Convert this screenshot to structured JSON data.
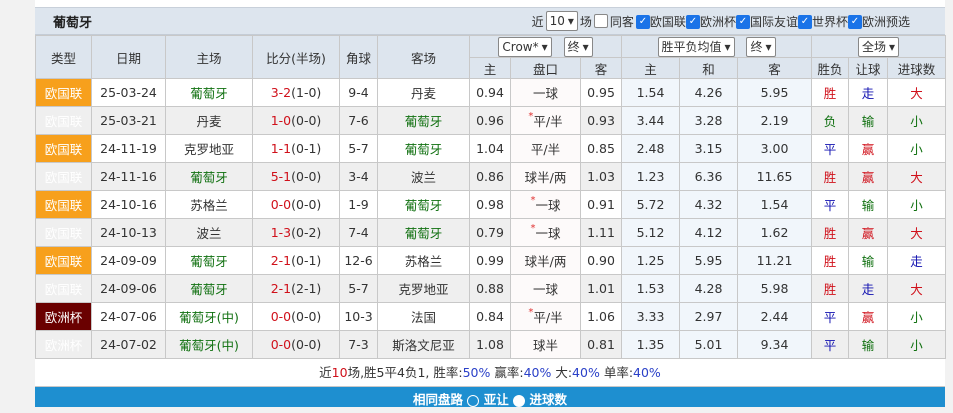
{
  "team": "葡萄牙",
  "filters": {
    "near_label": "近",
    "count": "10",
    "unit_label": "场",
    "same_host_label": "同客",
    "same_host": false,
    "competitions": [
      {
        "label": "欧国联",
        "checked": true
      },
      {
        "label": "欧洲杯",
        "checked": true
      },
      {
        "label": "国际友谊",
        "checked": true
      },
      {
        "label": "世界杯",
        "checked": true
      },
      {
        "label": "欧洲预选",
        "checked": true
      }
    ]
  },
  "headers": {
    "type": "类型",
    "date": "日期",
    "home": "主场",
    "score": "比分(半场)",
    "corner": "角球",
    "away": "客场",
    "ah_company": "Crow*",
    "ah_stage": "终",
    "eu_type": "胜平负均值",
    "eu_stage": "终",
    "period": "全场",
    "ah_home": "主",
    "ah_line": "盘口",
    "ah_away": "客",
    "eu_home": "主",
    "eu_draw": "和",
    "eu_away": "客",
    "result": "胜负",
    "handicap": "让球",
    "goals": "进球数"
  },
  "colors": {
    "欧国联": "#f7a01c",
    "欧洲杯": "#6a0000",
    "win": "#d0101a",
    "draw": "#1010b0",
    "loss": "#107010"
  },
  "rows": [
    {
      "type": "欧国联",
      "date": "25-03-24",
      "home": "葡萄牙",
      "home_hl": true,
      "ft": "3-2",
      "ht": "(1-0)",
      "corner": "9-4",
      "away": "丹麦",
      "away_hl": false,
      "ah_h": "0.94",
      "star": "",
      "line": "一球",
      "ah_a": "0.95",
      "eu_h": "1.54",
      "eu_d": "4.26",
      "eu_a": "5.95",
      "res": "胜",
      "hc": "走",
      "goals": "大"
    },
    {
      "type": "欧国联",
      "date": "25-03-21",
      "home": "丹麦",
      "home_hl": false,
      "ft": "1-0",
      "ht": "(0-0)",
      "corner": "7-6",
      "away": "葡萄牙",
      "away_hl": true,
      "ah_h": "0.96",
      "star": "*",
      "line": "平/半",
      "ah_a": "0.93",
      "eu_h": "3.44",
      "eu_d": "3.28",
      "eu_a": "2.19",
      "res": "负",
      "hc": "输",
      "goals": "小"
    },
    {
      "type": "欧国联",
      "date": "24-11-19",
      "home": "克罗地亚",
      "home_hl": false,
      "ft": "1-1",
      "ht": "(0-1)",
      "corner": "5-7",
      "away": "葡萄牙",
      "away_hl": true,
      "ah_h": "1.04",
      "star": "",
      "line": "平/半",
      "ah_a": "0.85",
      "eu_h": "2.48",
      "eu_d": "3.15",
      "eu_a": "3.00",
      "res": "平",
      "hc": "赢",
      "goals": "小"
    },
    {
      "type": "欧国联",
      "date": "24-11-16",
      "home": "葡萄牙",
      "home_hl": true,
      "ft": "5-1",
      "ht": "(0-0)",
      "corner": "3-4",
      "away": "波兰",
      "away_hl": false,
      "ah_h": "0.86",
      "star": "",
      "line": "球半/两",
      "ah_a": "1.03",
      "eu_h": "1.23",
      "eu_d": "6.36",
      "eu_a": "11.65",
      "res": "胜",
      "hc": "赢",
      "goals": "大"
    },
    {
      "type": "欧国联",
      "date": "24-10-16",
      "home": "苏格兰",
      "home_hl": false,
      "ft": "0-0",
      "ht": "(0-0)",
      "corner": "1-9",
      "away": "葡萄牙",
      "away_hl": true,
      "ah_h": "0.98",
      "star": "*",
      "line": "一球",
      "ah_a": "0.91",
      "eu_h": "5.72",
      "eu_d": "4.32",
      "eu_a": "1.54",
      "res": "平",
      "hc": "输",
      "goals": "小"
    },
    {
      "type": "欧国联",
      "date": "24-10-13",
      "home": "波兰",
      "home_hl": false,
      "ft": "1-3",
      "ht": "(0-2)",
      "corner": "7-4",
      "away": "葡萄牙",
      "away_hl": true,
      "ah_h": "0.79",
      "star": "*",
      "line": "一球",
      "ah_a": "1.11",
      "eu_h": "5.12",
      "eu_d": "4.12",
      "eu_a": "1.62",
      "res": "胜",
      "hc": "赢",
      "goals": "大"
    },
    {
      "type": "欧国联",
      "date": "24-09-09",
      "home": "葡萄牙",
      "home_hl": true,
      "ft": "2-1",
      "ht": "(0-1)",
      "corner": "12-6",
      "away": "苏格兰",
      "away_hl": false,
      "ah_h": "0.99",
      "star": "",
      "line": "球半/两",
      "ah_a": "0.90",
      "eu_h": "1.25",
      "eu_d": "5.95",
      "eu_a": "11.21",
      "res": "胜",
      "hc": "输",
      "goals": "走"
    },
    {
      "type": "欧国联",
      "date": "24-09-06",
      "home": "葡萄牙",
      "home_hl": true,
      "ft": "2-1",
      "ht": "(2-1)",
      "corner": "5-7",
      "away": "克罗地亚",
      "away_hl": false,
      "ah_h": "0.88",
      "star": "",
      "line": "一球",
      "ah_a": "1.01",
      "eu_h": "1.53",
      "eu_d": "4.28",
      "eu_a": "5.98",
      "res": "胜",
      "hc": "走",
      "goals": "大"
    },
    {
      "type": "欧洲杯",
      "date": "24-07-06",
      "home": "葡萄牙(中)",
      "home_hl": true,
      "ft": "0-0",
      "ht": "(0-0)",
      "corner": "10-3",
      "away": "法国",
      "away_hl": false,
      "ah_h": "0.84",
      "star": "*",
      "line": "平/半",
      "ah_a": "1.06",
      "eu_h": "3.33",
      "eu_d": "2.97",
      "eu_a": "2.44",
      "res": "平",
      "hc": "赢",
      "goals": "小"
    },
    {
      "type": "欧洲杯",
      "date": "24-07-02",
      "home": "葡萄牙(中)",
      "home_hl": true,
      "ft": "0-0",
      "ht": "(0-0)",
      "corner": "7-3",
      "away": "斯洛文尼亚",
      "away_hl": false,
      "ah_h": "1.08",
      "star": "",
      "line": "球半",
      "ah_a": "0.81",
      "eu_h": "1.35",
      "eu_d": "5.01",
      "eu_a": "9.34",
      "res": "平",
      "hc": "输",
      "goals": "小"
    }
  ],
  "summary": {
    "p1": "近",
    "n": "10",
    "p2": "场,胜5平4负1, 胜率:",
    "win_rate": "50%",
    "p3": " 赢率:",
    "ah_rate": "40%",
    "p4": " 大:",
    "over_rate": "40%",
    "p5": " 单率:",
    "odd_rate": "40%"
  },
  "footer": {
    "title": "相同盘路",
    "opt1": "亚让",
    "opt2": "进球数",
    "selected": "进球数"
  }
}
